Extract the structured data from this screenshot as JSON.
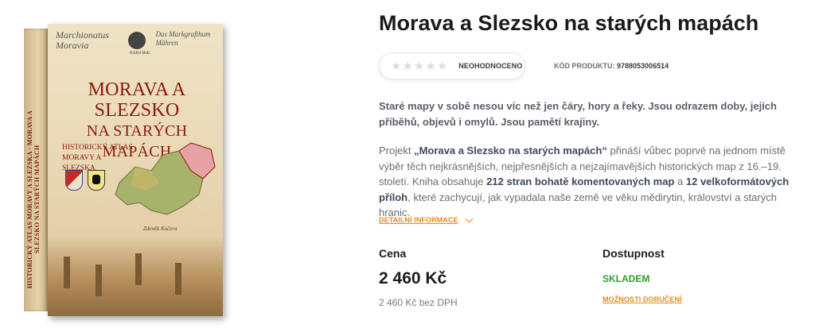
{
  "cover": {
    "spine_text": "HISTORICKÝ ATLAS MORAVY A SLEZSKA · MORAVA A SLEZSKO NA STARÝCH MAPÁCH",
    "marchionatus": "Marchionatus Moravia",
    "publisher": "Knižní klub",
    "fraktur": "Das Markgrafthum Mähren",
    "title_line1": "MORAVA A SLEZSKO",
    "title_line2": "NA STARÝCH MAPÁCH",
    "subtitle_line1": "HISTORICKÝ ATLAS",
    "subtitle_line2": "MORAVY A SLEZSKA",
    "author": "Zdeněk Kučera"
  },
  "product": {
    "title": "Morava a Slezsko na starých mapách",
    "rating": {
      "stars": 0,
      "max": 5,
      "label": "NEOHODNOCENO"
    },
    "code_label": "KÓD PRODUKTU:",
    "code_value": "9788053006514",
    "lead": "Staré mapy v sobě nesou víc než jen čáry, hory a řeky. Jsou odrazem doby, jejích příběhů, objevů i omylů. Jsou pamětí krajiny.",
    "desc": {
      "p1": "Projekt ",
      "b1": "„Morava a Slezsko na starých mapách“",
      "p2": " přináší vůbec poprvé na jednom místě výběr těch nejkrásnějších, nejpřesnějších a nejzajímavějších historických map z 16.–19. století. Kniha obsahuje ",
      "b2": "212 stran bohatě komentovaných map",
      "p3": " a ",
      "b3": "12 velkoformátových příloh",
      "p4": ", které zachycují, jak vypadala naše země ve věku mědirytin, království a starých hranic."
    },
    "details_link": "DETAILNÍ INFORMACE",
    "price_label": "Cena",
    "price": "2 460 Kč",
    "price_net": "2 460 Kč bez DPH",
    "availability_label": "Dostupnost",
    "stock": "SKLADEM",
    "delivery_link": "MOŽNOSTI DORUČENÍ"
  },
  "colors": {
    "accent": "#e58a1b",
    "stock_green": "#2f9e2a",
    "cover_red": "#8d1a0c"
  }
}
